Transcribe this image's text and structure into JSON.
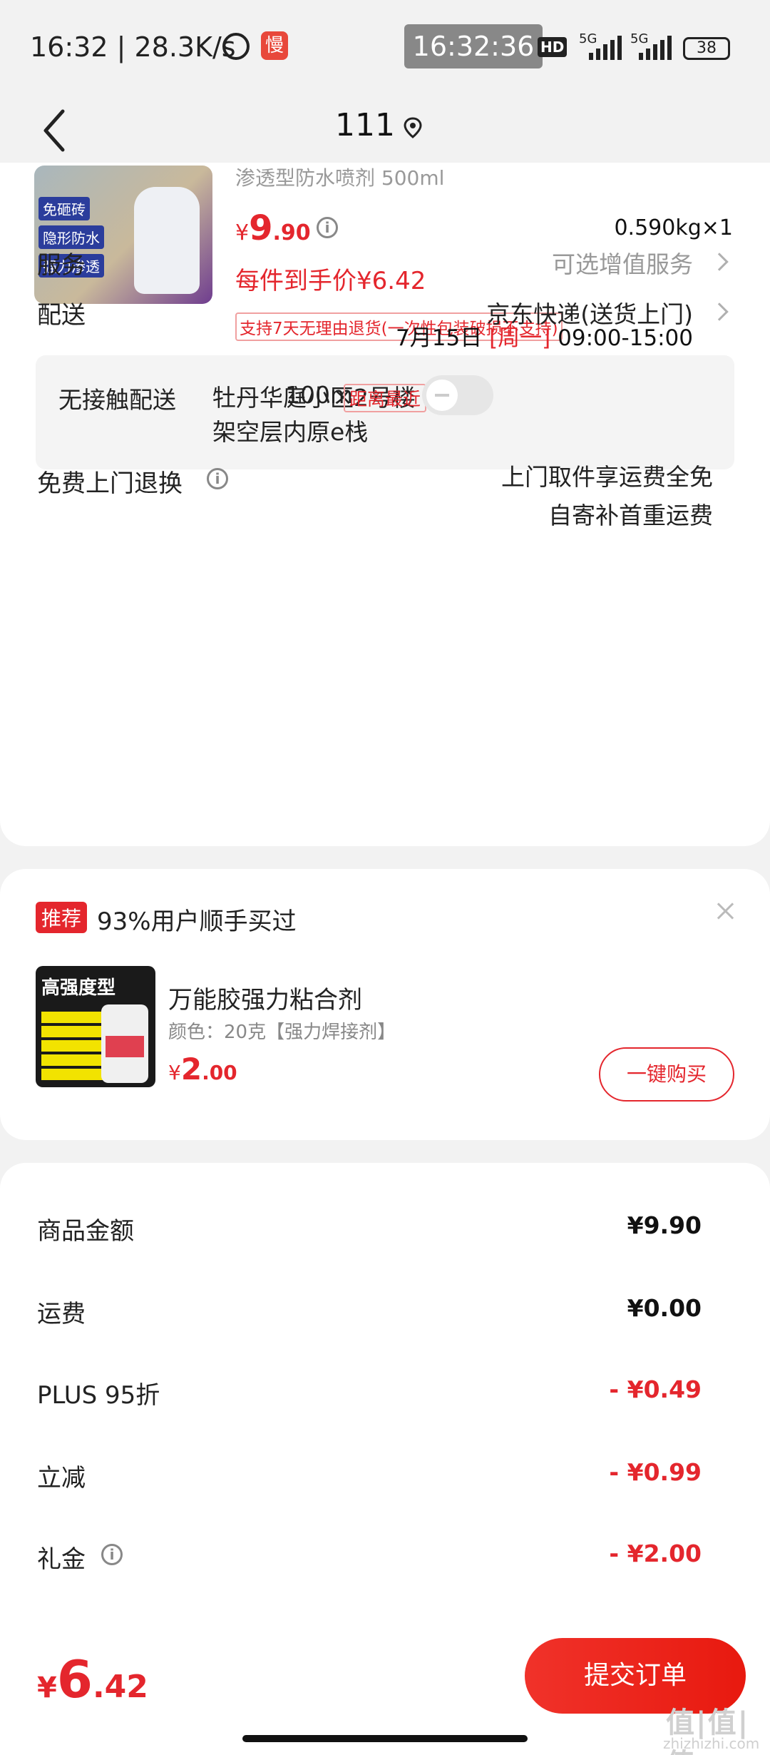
{
  "status_bar": {
    "time": "16:32 | 28.3K/s",
    "clock": "16:32:36",
    "hd": "HD",
    "net1": "5G",
    "net2": "5G",
    "battery": "38",
    "app_icon_text": "慢"
  },
  "nav": {
    "title": "111"
  },
  "product": {
    "name": "渗透型防水喷剂 500ml",
    "image_tags": [
      "免砸砖",
      "隐形防水",
      "强力渗透"
    ],
    "price_yen": "¥",
    "price_int": "9",
    "price_dec": ".90",
    "weight": "0.590kg×1",
    "unit_price": "每件到手价¥6.42",
    "return_policy": "支持7天无理由退货(一次性包装破损不支持)"
  },
  "service": {
    "label": "服务",
    "value": "可选增值服务"
  },
  "delivery": {
    "label": "配送",
    "value": "京东快递(送货上门)",
    "date": "7月15日 ",
    "weekday": "[周一]",
    "time_range": " 09:00-15:00"
  },
  "no_contact": {
    "label": "无接触配送",
    "address": "牡丹华庭小区2号楼 架空层内原e栈",
    "distance": "100m",
    "nearest": "距离最近",
    "enabled": false
  },
  "free_return": {
    "label": "免费上门退换",
    "line1": "上门取件享运费全免",
    "line2": "自寄补首重运费"
  },
  "recommend": {
    "badge": "推荐",
    "text": "93%用户顺手买过",
    "product_name": "万能胶强力粘合剂",
    "spec": "颜色：20克【强力焊接剂】",
    "price_yen": "¥",
    "price_int": "2",
    "price_dec": ".00",
    "buy_label": "一键购买",
    "image_title": "高强度型"
  },
  "summary": [
    {
      "label": "商品金额",
      "value": "¥9.90",
      "red": false
    },
    {
      "label": "运费",
      "value": "¥0.00",
      "red": false
    },
    {
      "label": "PLUS 95折",
      "value": "- ¥0.49",
      "red": true
    },
    {
      "label": "立减",
      "value": "- ¥0.99",
      "red": true
    },
    {
      "label": "礼金",
      "value": "- ¥2.00",
      "red": true
    }
  ],
  "bottom": {
    "total_yen": "¥",
    "total_int": "6",
    "total_dec": ".42",
    "submit_label": "提交订单",
    "watermark": "值|值|值",
    "watermark_sub": "zhizhizhi.com"
  },
  "colors": {
    "accent_red": "#e4262d",
    "background": "#f2f2f2"
  }
}
